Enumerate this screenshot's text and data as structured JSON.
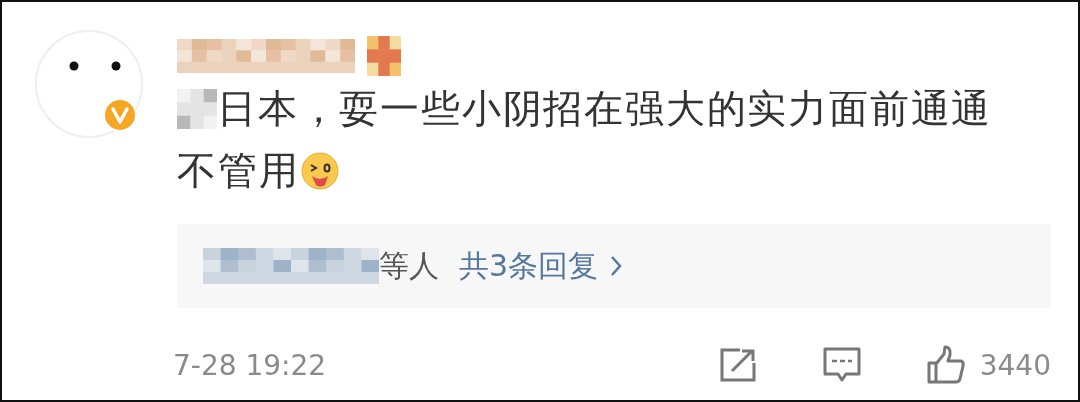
{
  "comment": {
    "author": {
      "verified": true
    },
    "text_lines": [
      "日本，耍一些小阴招在强大的实力面前通通",
      "不管用"
    ],
    "replies": {
      "suffix": "等人",
      "link": "共3条回复"
    },
    "time": "7-28 19:22",
    "likes": "3440"
  }
}
